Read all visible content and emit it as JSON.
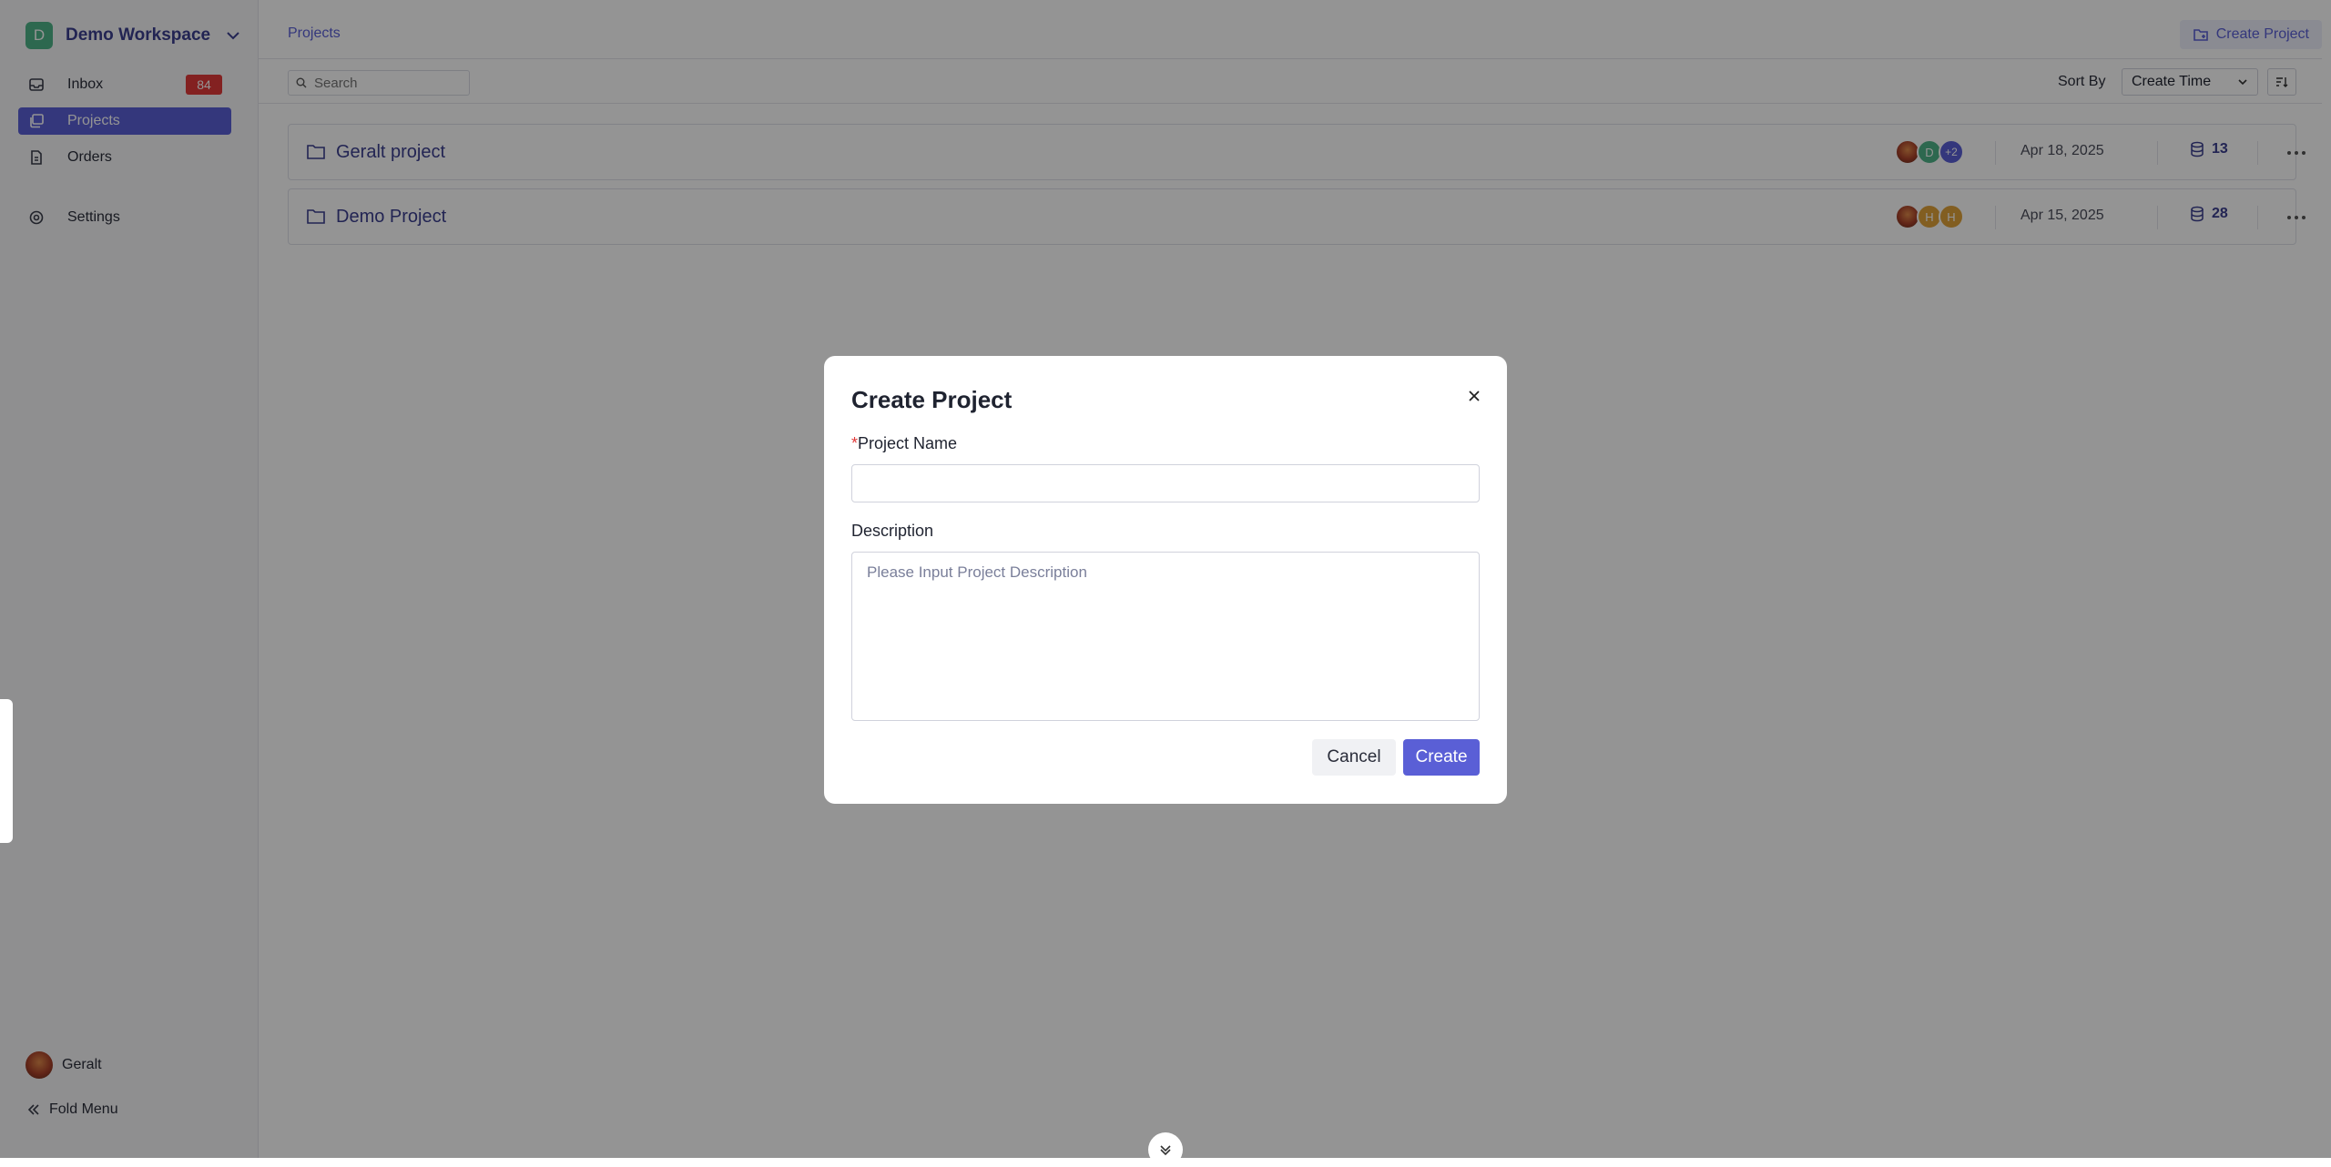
{
  "workspace": {
    "initial": "D",
    "name": "Demo Workspace"
  },
  "sidebar": {
    "items": [
      {
        "label": "Inbox",
        "badge": "84"
      },
      {
        "label": "Projects"
      },
      {
        "label": "Orders"
      },
      {
        "label": "Settings"
      }
    ],
    "active": "Projects",
    "user": {
      "name": "Geralt"
    },
    "fold_label": "Fold Menu"
  },
  "header": {
    "breadcrumb": "Projects",
    "create_button": "Create Project"
  },
  "toolbar": {
    "search_placeholder": "Search",
    "sort_label": "Sort By",
    "sort_value": "Create Time"
  },
  "projects": [
    {
      "name": "Geralt project",
      "members": [
        "img",
        "D",
        "+2"
      ],
      "date": "Apr 18, 2025",
      "count": "13"
    },
    {
      "name": "Demo Project",
      "members": [
        "img",
        "H",
        "H"
      ],
      "date": "Apr 15, 2025",
      "count": "28"
    }
  ],
  "modal": {
    "title": "Create Project",
    "required_mark": "*",
    "name_label": "Project Name",
    "name_value": "",
    "description_label": "Description",
    "description_placeholder": "Please Input Project Description",
    "cancel_label": "Cancel",
    "create_label": "Create"
  },
  "colors": {
    "accent": "#5a5fd6",
    "badge": "#e23a3a",
    "workspace_avatar": "#4fb389",
    "member_d": "#4fb389",
    "member_plus": "#5a5fd6",
    "member_h": "#e0a33a"
  }
}
